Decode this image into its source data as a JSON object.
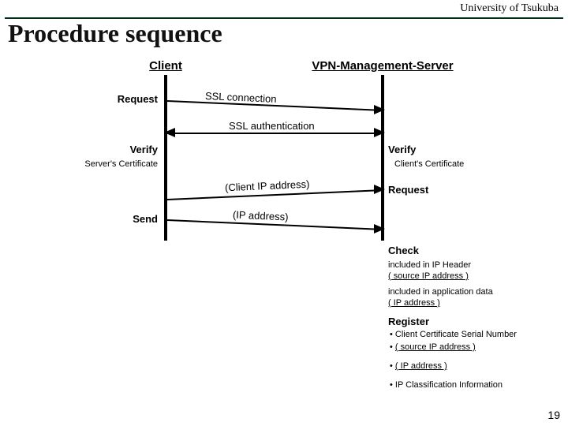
{
  "header": {
    "institution": "University of Tsukuba"
  },
  "title": "Procedure sequence",
  "columns": {
    "left": "Client",
    "right": "VPN-Management-Server"
  },
  "left_events": {
    "request": "Request",
    "verify": "Verify",
    "server_cert": "Server's Certificate",
    "send": "Send"
  },
  "right_events": {
    "verify": "Verify",
    "client_cert": "Client's Certificate",
    "request": "Request",
    "check": "Check",
    "check_note1_line1": "included in IP Header",
    "check_note1_line2": "( source IP address )",
    "check_note2_line1": "included in application data",
    "check_note2_line2": "( IP address )",
    "register": "Register",
    "reg_b1": "• Client Certificate Serial Number",
    "reg_b2_prefix": "• ",
    "reg_b2": "( source IP address )",
    "reg_b3_prefix": "• ",
    "reg_b3": "( IP address )",
    "reg_b4": "• IP Classification Information"
  },
  "messages": {
    "ssl_conn": "SSL connection",
    "ssl_auth": "SSL authentication",
    "client_ip": "(Client IP address)",
    "ip_addr": "(IP address)"
  },
  "slide_number": "19"
}
